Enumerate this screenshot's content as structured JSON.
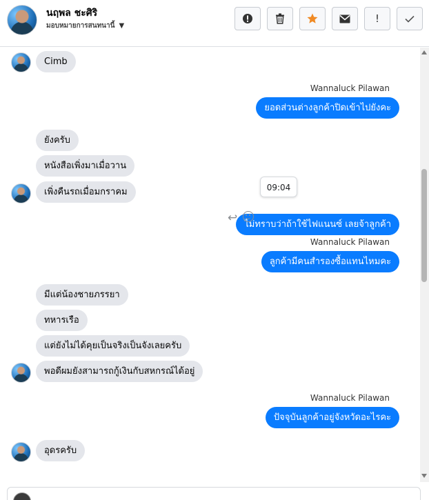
{
  "header": {
    "contact_name": "นฤพล ชะศิริ",
    "subtitle": "มอบหมายการสนทนานี้",
    "toolbar": [
      {
        "name": "spam-button",
        "icon": "alert-circle-icon",
        "label": "!"
      },
      {
        "name": "delete-button",
        "icon": "trash-icon",
        "label": ""
      },
      {
        "name": "star-button",
        "icon": "star-icon",
        "label": "★"
      },
      {
        "name": "mark-unread-button",
        "icon": "mail-icon",
        "label": ""
      },
      {
        "name": "follow-up-button",
        "icon": "exclamation-icon",
        "label": "!"
      },
      {
        "name": "done-button",
        "icon": "check-icon",
        "label": "✓"
      }
    ],
    "star_color": "#f08a24"
  },
  "messages": [
    {
      "dir": "in",
      "text": "Cimb",
      "avatar": true
    },
    {
      "dir": "out",
      "sender": "Wannaluck Pilawan",
      "text": "ยอดส่วนต่างลูกค้าปิดเข้าไปยังคะ"
    },
    {
      "dir": "in",
      "text": "ยังครับ",
      "avatar": false
    },
    {
      "dir": "in",
      "text": "หนังสือเพิ่งมาเมื่อวาน",
      "avatar": false
    },
    {
      "dir": "in",
      "text": "เพิ่งคืนรถเมื่อมกราคม",
      "avatar": true
    },
    {
      "dir": "out",
      "text": "ไม่ทราบว่าถ้าใช้ไฟแนนซ์ เลยจ้าลูกค้า"
    },
    {
      "dir": "out",
      "sender": "Wannaluck Pilawan",
      "text": "ลูกค้ามีคนสำรองซื้อแทนไหมคะ"
    },
    {
      "dir": "in",
      "text": "มีแต่น้องชายภรรยา",
      "avatar": false
    },
    {
      "dir": "in",
      "text": "ทหารเรือ",
      "avatar": false
    },
    {
      "dir": "in",
      "text": "แต่ยังไม่ได้คุยเป็นจริงเป็นจังเลยครับ",
      "avatar": false
    },
    {
      "dir": "in",
      "text": "พอดีผมยังสามารถกู้เงินกับสหกรณ์ได้อยู่",
      "avatar": true
    },
    {
      "dir": "out",
      "sender": "Wannaluck Pilawan",
      "text": "ปัจจุบันลูกค้าอยู่จังหวัดอะไรคะ"
    },
    {
      "dir": "in",
      "text": "อุดรครับ",
      "avatar": true
    }
  ],
  "tooltip": {
    "time": "09:04"
  },
  "hover_actions": {
    "reply_icon": "reply-icon",
    "react_icon": "smile-icon"
  },
  "colors": {
    "outgoing": "#0a7cff",
    "incoming": "#e4e6eb"
  }
}
